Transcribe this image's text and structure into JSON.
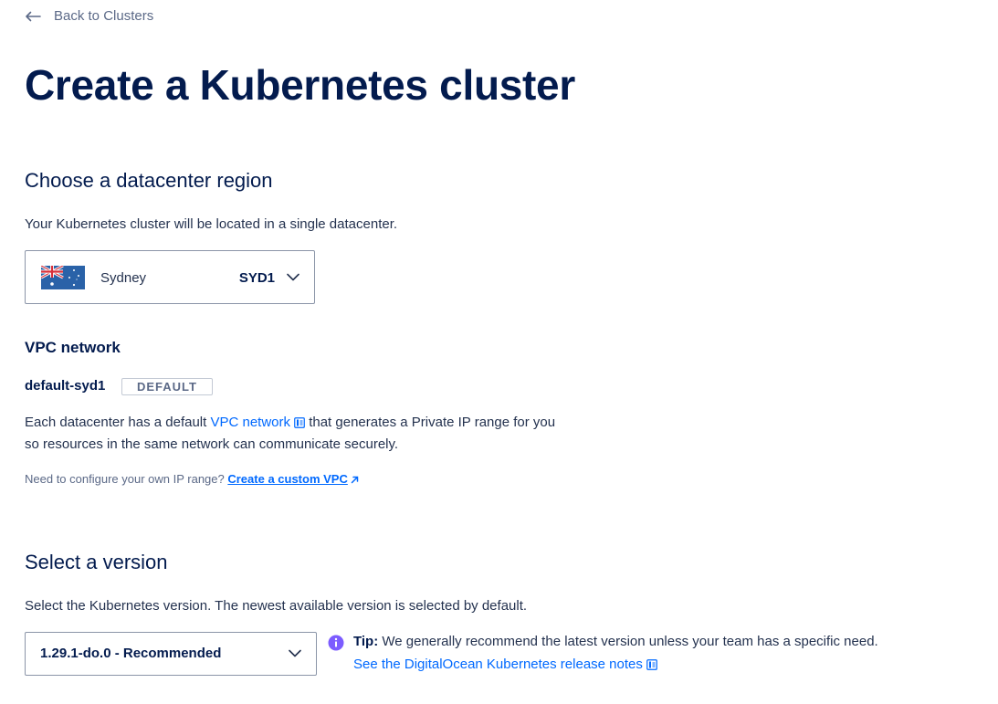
{
  "nav": {
    "back_label": "Back to Clusters"
  },
  "page": {
    "title": "Create a Kubernetes cluster"
  },
  "region": {
    "title": "Choose a datacenter region",
    "description": "Your Kubernetes cluster will be located in a single datacenter.",
    "selected_name": "Sydney",
    "selected_code": "SYD1",
    "flag_icon": "australia-flag-icon"
  },
  "vpc": {
    "label": "VPC network",
    "name": "default-syd1",
    "badge": "DEFAULT",
    "desc_before": "Each datacenter has a default ",
    "desc_link": "VPC network",
    "desc_after": " that generates a Private IP range for you so resources in the same network can communicate securely.",
    "custom_prompt": "Need to configure your own IP range? ",
    "custom_link": "Create a custom VPC"
  },
  "version": {
    "title": "Select a version",
    "description": "Select the Kubernetes version. The newest available version is selected by default.",
    "selected": "1.29.1-do.0 - Recommended",
    "tip_label": "Tip:",
    "tip_text": " We generally recommend the latest version unless your team has a specific need.",
    "tip_link": "See the DigitalOcean Kubernetes release notes"
  },
  "colors": {
    "heading": "#031b4e",
    "link": "#0069ff",
    "info": "#7c5cff",
    "border": "#8b95a8"
  }
}
